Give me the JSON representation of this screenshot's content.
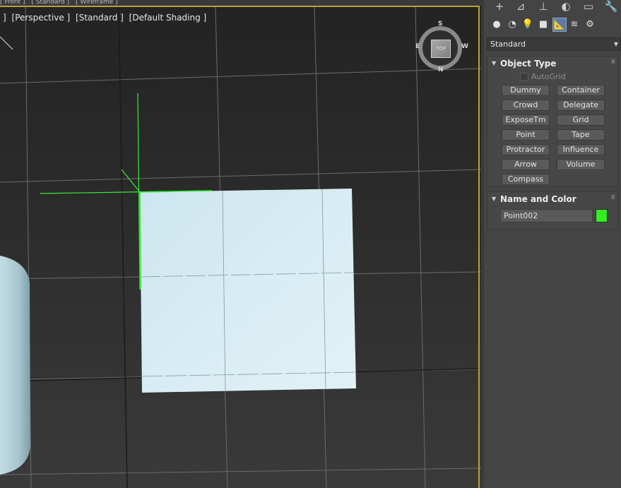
{
  "top_strip": {
    "items": [
      "[ Front ]",
      "[ Standard ]",
      "[ Wireframe ]"
    ]
  },
  "viewport": {
    "labels": [
      "]",
      "[Perspective ]",
      "[Standard ]",
      "[Default Shading ]"
    ],
    "viewcube": {
      "top": "S",
      "left": "E",
      "right": "W",
      "bottom": "N",
      "face": "TOP"
    }
  },
  "panel": {
    "tabs": [
      {
        "name": "create-tab",
        "glyph": "+"
      },
      {
        "name": "modify-tab",
        "glyph": "⊿"
      },
      {
        "name": "hierarchy-tab",
        "glyph": "⊥"
      },
      {
        "name": "motion-tab",
        "glyph": "◐"
      },
      {
        "name": "display-tab",
        "glyph": "▭"
      },
      {
        "name": "utilities-tab",
        "glyph": "🔧"
      }
    ],
    "categories": [
      {
        "name": "geometry-icon",
        "glyph": "●"
      },
      {
        "name": "shapes-icon",
        "glyph": "◔"
      },
      {
        "name": "lights-icon",
        "glyph": "💡"
      },
      {
        "name": "cameras-icon",
        "glyph": "■"
      },
      {
        "name": "helpers-icon",
        "glyph": "📐"
      },
      {
        "name": "spacewarps-icon",
        "glyph": "≋"
      },
      {
        "name": "systems-icon",
        "glyph": "⚙"
      }
    ],
    "dropdown": {
      "selected": "Standard"
    },
    "object_type": {
      "title": "Object Type",
      "autogrid_label": "AutoGrid",
      "buttons": [
        "Dummy",
        "Container",
        "Crowd",
        "Delegate",
        "ExposeTm",
        "Grid",
        "Point",
        "Tape",
        "Protractor",
        "Influence",
        "Arrow",
        "Volume",
        "Compass"
      ]
    },
    "name_and_color": {
      "title": "Name and Color",
      "name_value": "Point002",
      "color": "#33ee22"
    }
  }
}
